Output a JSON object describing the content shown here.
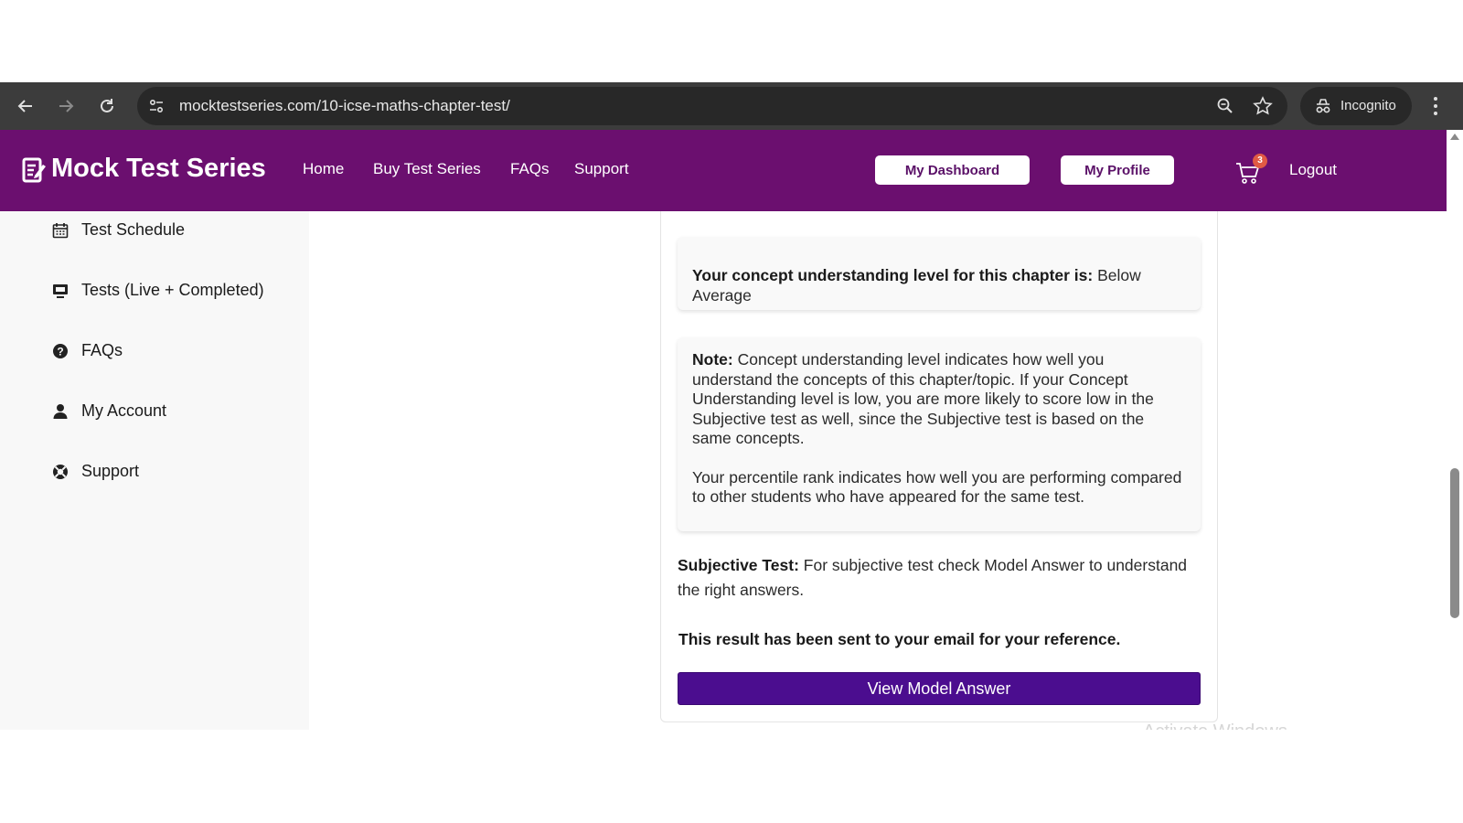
{
  "browser": {
    "url_domain": "mocktestseries.com",
    "url_path": "/10-icse-maths-chapter-test/",
    "incognito_label": "Incognito"
  },
  "header": {
    "brand": "Mock Test Series",
    "nav": [
      "Home",
      "Buy Test Series",
      "FAQs",
      "Support"
    ],
    "dashboard_button": "My Dashboard",
    "profile_button": "My Profile",
    "cart_count": "3",
    "logout": "Logout",
    "bg_color": "#6b0f6f"
  },
  "sidebar": {
    "items": [
      {
        "label": "Test Schedule",
        "icon": "calendar-icon"
      },
      {
        "label": "Tests (Live + Completed)",
        "icon": "monitor-icon"
      },
      {
        "label": "FAQs",
        "icon": "question-circle-icon"
      },
      {
        "label": "My Account",
        "icon": "user-icon"
      },
      {
        "label": "Support",
        "icon": "lifebuoy-icon"
      }
    ]
  },
  "result": {
    "concept_label": "Your concept understanding level for this chapter is:",
    "concept_value": "Below Average",
    "note_label": "Note:",
    "note_text": "Concept understanding level indicates how well you understand the concepts of this chapter/topic. If your Concept Understanding level is low, you are more likely to score low in the Subjective test as well, since the Subjective test is based on the same concepts.",
    "percentile_text": "Your percentile rank indicates how well you are performing compared to other students who have appeared for the same test.",
    "subjective_label": "Subjective Test:",
    "subjective_text": "For subjective test check Model Answer to understand the right answers.",
    "email_notice": "This result has been sent to your email for your reference.",
    "view_model_button": "View Model Answer",
    "button_color": "#4b0d8f"
  },
  "overlay": {
    "watermark": "Activate Windows"
  }
}
